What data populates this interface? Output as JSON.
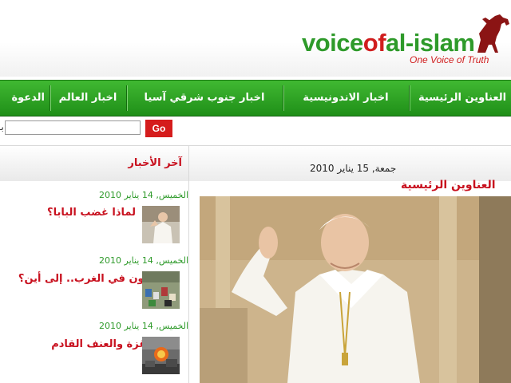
{
  "header": {
    "logo_part1": "voice",
    "logo_part2": "of",
    "logo_part3": "al-islam",
    "tagline": "One Voice of Truth",
    "brand_colors": {
      "green": "#2e9a2a",
      "red": "#d01e1e"
    }
  },
  "nav": {
    "items": [
      {
        "label": "العناوين الرئيسية"
      },
      {
        "label": "اخبار الاندونيسية"
      },
      {
        "label": "اخبار جنوب شرقي آسيا"
      },
      {
        "label": "اخبار العالم"
      },
      {
        "label": "الدعوة"
      }
    ]
  },
  "search": {
    "label": "بـ",
    "value": "",
    "button_label": "Go"
  },
  "main": {
    "date": "جمعة, 15 يناير 2010",
    "section_title": "العناوين الرئيسية"
  },
  "sidebar": {
    "title": "آخر الأخبار",
    "items": [
      {
        "date": "الخميس, 14 يناير 2010",
        "title": "لماذا غضب البابا؟"
      },
      {
        "date": "الخميس, 14 يناير 2010",
        "title": "المسلمون في الغرب.. إلى أين؟"
      },
      {
        "date": "الخميس, 14 يناير 2010",
        "title": "مأساة غزة والعنف القادم"
      }
    ]
  }
}
